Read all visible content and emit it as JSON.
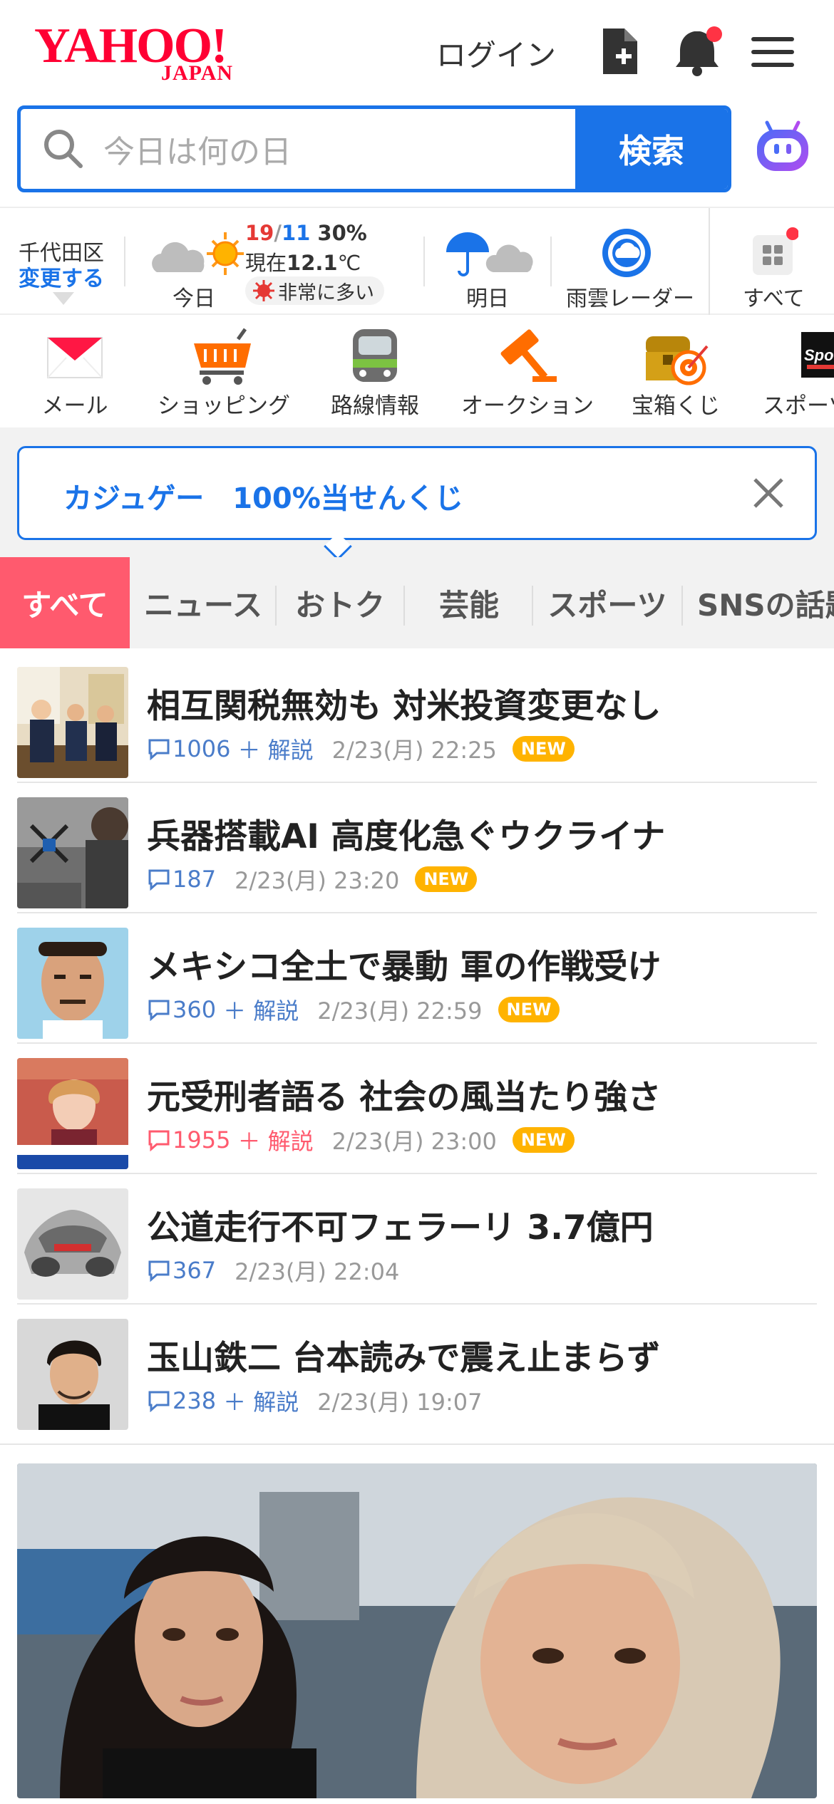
{
  "header": {
    "logo_main": "YAHOO!",
    "logo_sub": "JAPAN",
    "login_label": "ログイン"
  },
  "search": {
    "placeholder": "今日は何の日",
    "button_label": "検索"
  },
  "weather": {
    "location": "千代田区",
    "change_label": "変更する",
    "today_label": "今日",
    "temp_hi": "19",
    "temp_sep": "/",
    "temp_lo": "11",
    "precip": "30%",
    "current_prefix": "現在",
    "current_temp": "12.1",
    "current_unit": "℃",
    "pollen_label": "非常に多い",
    "tomorrow_label": "明日",
    "radar_label": "雨雲レーダー",
    "all_label": "すべて"
  },
  "services": [
    {
      "label": "メール",
      "icon": "mail-icon"
    },
    {
      "label": "ショッピング",
      "icon": "shopping-cart-icon"
    },
    {
      "label": "路線情報",
      "icon": "train-icon"
    },
    {
      "label": "オークション",
      "icon": "auction-gavel-icon"
    },
    {
      "label": "宝箱くじ",
      "icon": "treasure-box-icon"
    },
    {
      "label": "スポーツ",
      "icon": "sports-icon"
    }
  ],
  "promo": {
    "text": "カジュゲー　100%当せんくじ"
  },
  "tabs": [
    {
      "label": "すべて"
    },
    {
      "label": "ニュース"
    },
    {
      "label": "おトク"
    },
    {
      "label": "芸能"
    },
    {
      "label": "スポーツ"
    },
    {
      "label": "SNSの話題"
    }
  ],
  "news": [
    {
      "title": "相互関税無効も 対米投資変更なし",
      "count": "1006",
      "extra": "＋ 解説",
      "time": "2/23(月) 22:25",
      "badge": "NEW"
    },
    {
      "title": "兵器搭載AI 高度化急ぐウクライナ",
      "count": "187",
      "extra": "",
      "time": "2/23(月) 23:20",
      "badge": "NEW"
    },
    {
      "title": "メキシコ全土で暴動 軍の作戦受け",
      "count": "360",
      "extra": "＋ 解説",
      "time": "2/23(月) 22:59",
      "badge": "NEW"
    },
    {
      "title": "元受刑者語る 社会の風当たり強さ",
      "count": "1955",
      "extra": "＋ 解説",
      "time": "2/23(月) 23:00",
      "badge": "NEW"
    },
    {
      "title": "公道走行不可フェラーリ 3.7億円",
      "count": "367",
      "extra": "",
      "time": "2/23(月) 22:04",
      "badge": ""
    },
    {
      "title": "玉山鉄二 台本読みで震え止まらず",
      "count": "238",
      "extra": "＋ 解説",
      "time": "2/23(月) 19:07",
      "badge": ""
    }
  ],
  "colors": {
    "brand_red": "#ff0033",
    "accent_blue": "#1a73e8",
    "tab_active": "#ff5a6e",
    "badge_new": "#ffb300"
  }
}
